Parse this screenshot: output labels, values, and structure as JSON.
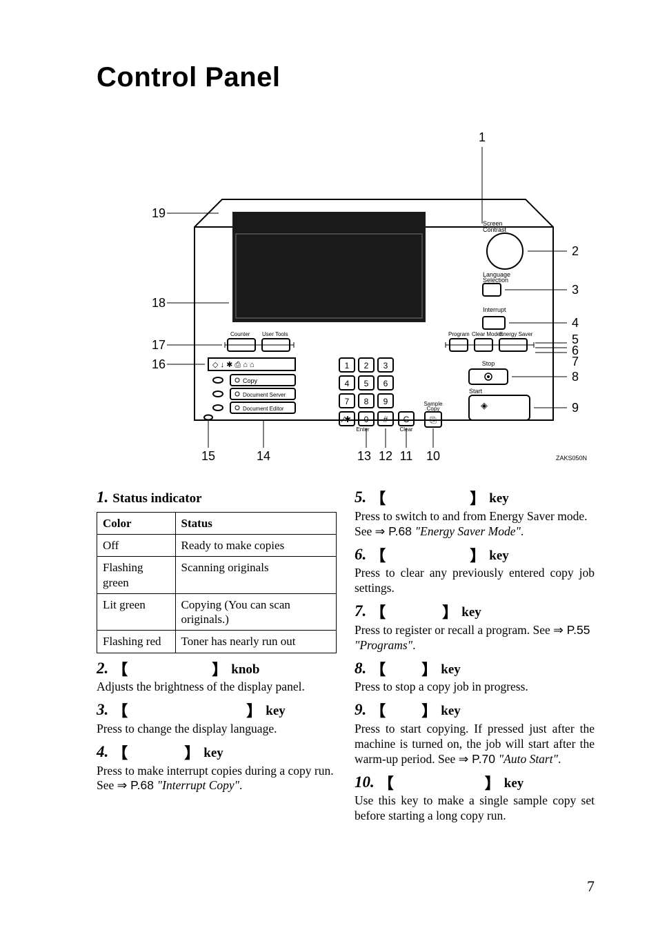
{
  "page": {
    "title": "Control Panel",
    "number": "7"
  },
  "diagram": {
    "callouts": [
      "1",
      "2",
      "3",
      "4",
      "5",
      "6",
      "7",
      "8",
      "9",
      "10",
      "11",
      "12",
      "13",
      "14",
      "15",
      "16",
      "17",
      "18",
      "19"
    ],
    "labels": {
      "screen_contrast": "Screen\nContrast",
      "language_selection": "Language\nSelection",
      "interrupt": "Interrupt",
      "counter": "Counter",
      "user_tools": "User Tools",
      "program": "Program",
      "clear_modes": "Clear Modes",
      "energy_saver": "Energy Saver",
      "stop": "Stop",
      "start": "Start",
      "sample_copy": "Sample\nCopy",
      "enter": "Enter",
      "clear": "Clear",
      "copy": "Copy",
      "document_server": "Document Server",
      "document_editor": "Document Editor",
      "part_no": "ZAKS050N"
    }
  },
  "items": [
    {
      "num": "1.",
      "title": "Status indicator",
      "type": "table",
      "table": {
        "headers": [
          "Color",
          "Status"
        ],
        "rows": [
          [
            "Off",
            "Ready to make copies"
          ],
          [
            "Flashing green",
            "Scanning originals"
          ],
          [
            "Lit green",
            "Copying (You can scan originals.)"
          ],
          [
            "Flashing red",
            "Toner has nearly run out"
          ]
        ]
      }
    },
    {
      "num": "2.",
      "brackets": true,
      "suffix": "knob",
      "body": "Adjusts the brightness of the display panel."
    },
    {
      "num": "3.",
      "brackets": true,
      "suffix": "key",
      "body": "Press to change the display language."
    },
    {
      "num": "4.",
      "brackets": true,
      "suffix": "key",
      "body_pre": "Press to make interrupt copies during a copy run. See ",
      "ref": "⇒ P.68 ",
      "ital": "\"Interrupt Copy\"",
      "body_post": "."
    },
    {
      "num": "5.",
      "brackets": true,
      "suffix": "key",
      "body_pre": "Press to switch to and from Energy Saver mode. See ",
      "ref": "⇒ P.68 ",
      "ital": "\"Energy Saver Mode\"",
      "body_post": "."
    },
    {
      "num": "6.",
      "brackets": true,
      "suffix": "key",
      "body": "Press to clear any previously entered copy job settings."
    },
    {
      "num": "7.",
      "brackets": true,
      "suffix": "key",
      "body_pre": "Press to register or recall a program. See ",
      "ref": "⇒ P.55 ",
      "ital": "\"Programs\"",
      "body_post": "."
    },
    {
      "num": "8.",
      "brackets": true,
      "suffix": "key",
      "body": "Press to stop a copy job in progress."
    },
    {
      "num": "9.",
      "brackets": true,
      "suffix": "key",
      "body_pre": "Press to start copying. If pressed just after the machine is turned on, the job will start after the warm-up period. See ",
      "ref": "⇒ P.70 ",
      "ital": "\"Auto Start\"",
      "body_post": "."
    },
    {
      "num": "10.",
      "brackets": true,
      "suffix": "key",
      "body": "Use this key to make a single sample copy set before starting a long copy run."
    }
  ]
}
